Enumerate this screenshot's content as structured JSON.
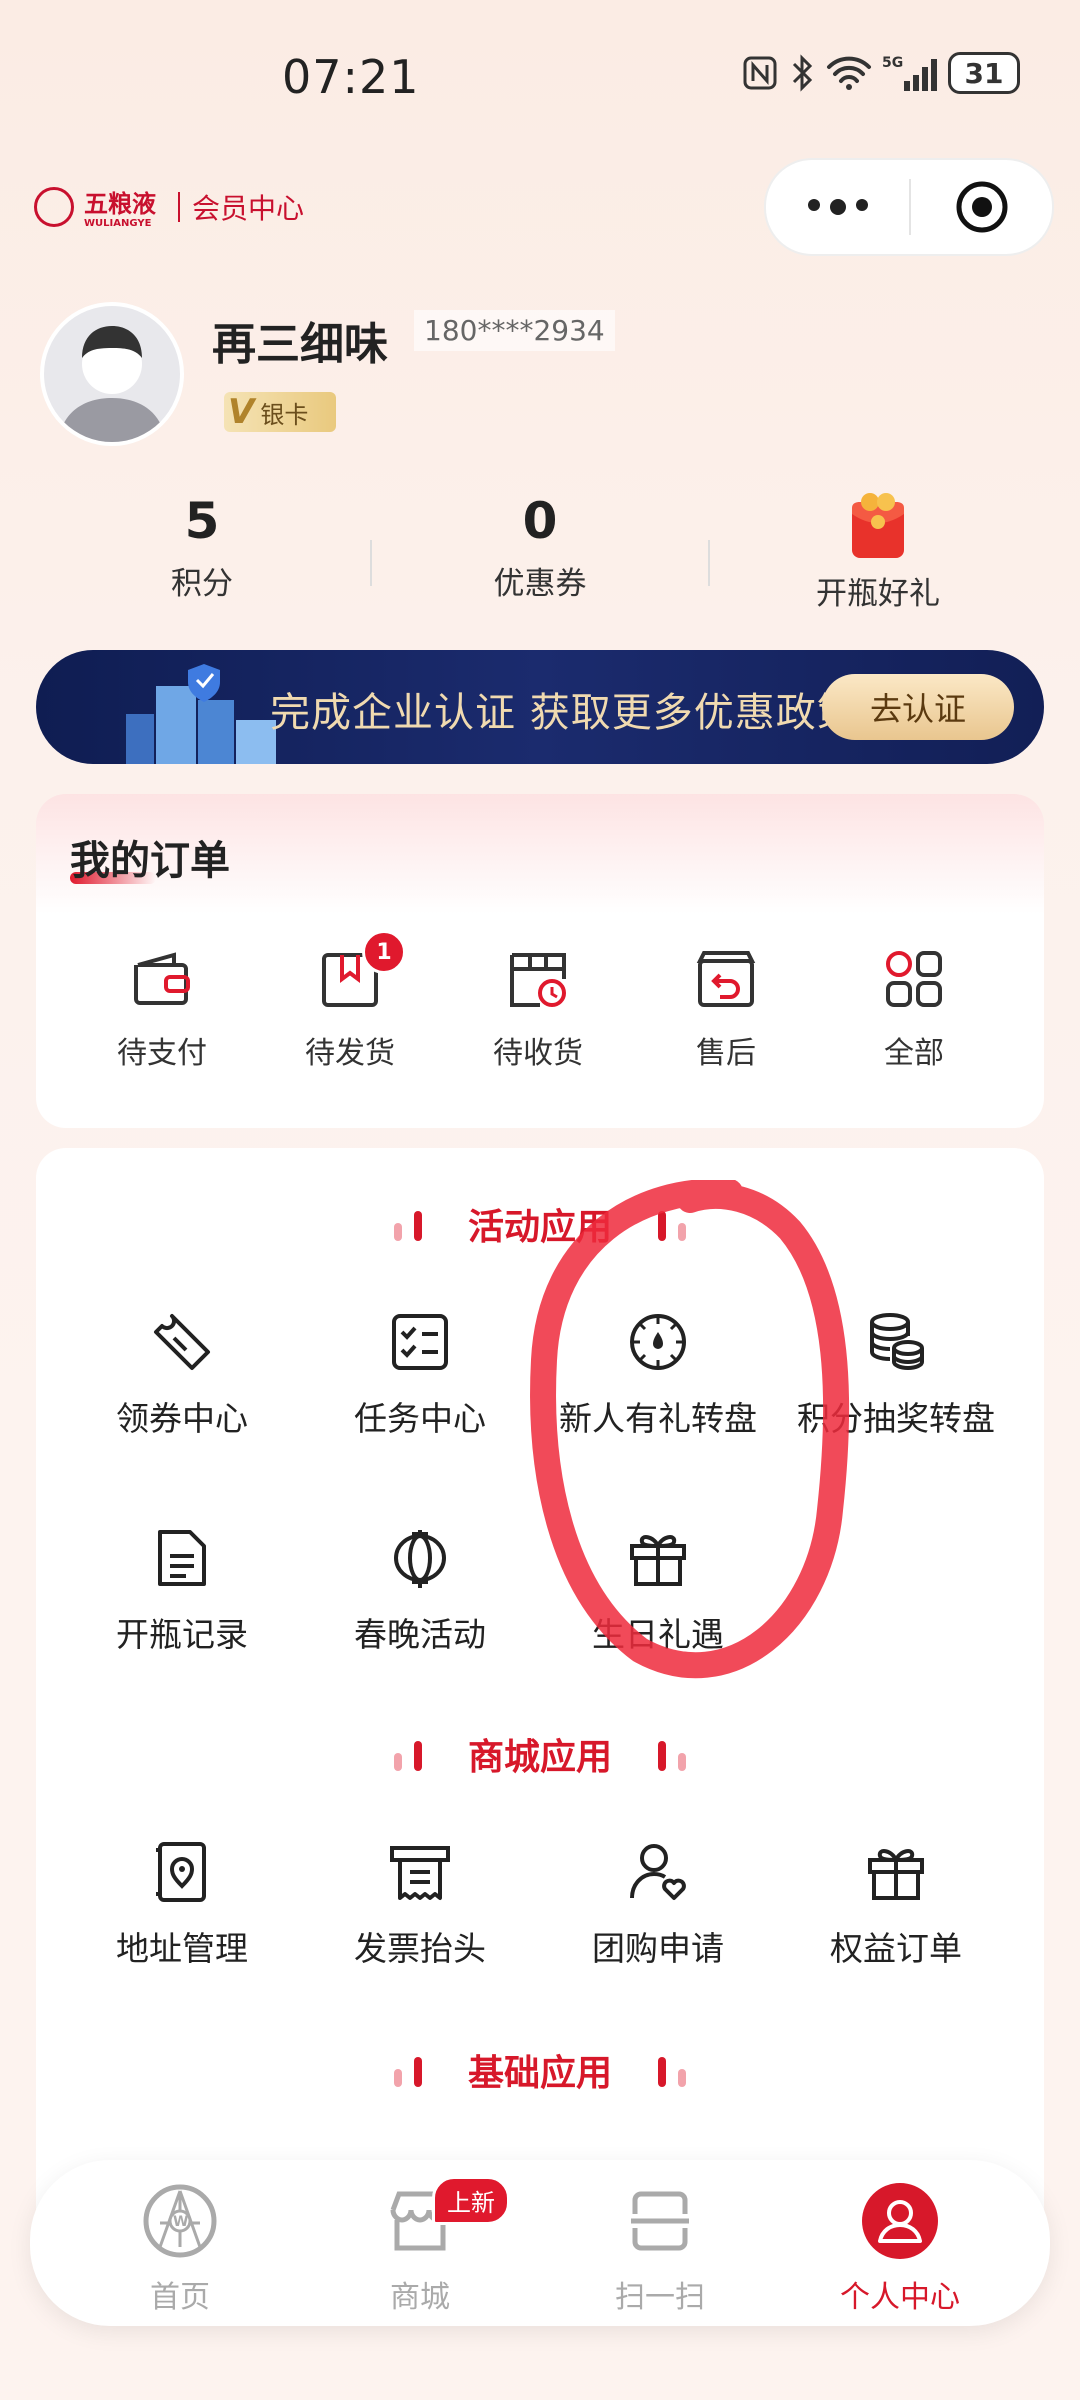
{
  "status_bar": {
    "time": "07:21",
    "battery": "31"
  },
  "header": {
    "brand_name": "五粮液",
    "brand_sub": "WULIANGYE",
    "brand_section": "会员中心"
  },
  "profile": {
    "nickname": "再三细味",
    "phone": "180****2934",
    "tier": "银卡"
  },
  "stats": [
    {
      "value": "5",
      "label": "积分"
    },
    {
      "value": "0",
      "label": "优惠券"
    },
    {
      "label": "开瓶好礼"
    }
  ],
  "banner": {
    "text": "完成企业认证 获取更多优惠政策",
    "button": "去认证"
  },
  "orders": {
    "title": "我的订单",
    "items": [
      {
        "label": "待支付",
        "icon": "wallet-icon"
      },
      {
        "label": "待发货",
        "icon": "package-icon",
        "badge": "1"
      },
      {
        "label": "待收货",
        "icon": "box-clock-icon"
      },
      {
        "label": "售后",
        "icon": "return-box-icon"
      },
      {
        "label": "全部",
        "icon": "grid-icon"
      }
    ]
  },
  "activity": {
    "title": "活动应用",
    "items": [
      {
        "label": "领券中心",
        "icon": "coupon-icon"
      },
      {
        "label": "任务中心",
        "icon": "checklist-icon"
      },
      {
        "label": "新人有礼转盘",
        "icon": "dial-icon"
      },
      {
        "label": "积分抽奖转盘",
        "icon": "coins-icon"
      },
      {
        "label": "开瓶记录",
        "icon": "document-icon"
      },
      {
        "label": "春晚活动",
        "icon": "lantern-icon"
      },
      {
        "label": "生日礼遇",
        "icon": "gift-icon"
      }
    ]
  },
  "mall": {
    "title": "商城应用",
    "items": [
      {
        "label": "地址管理",
        "icon": "location-book-icon"
      },
      {
        "label": "发票抬头",
        "icon": "invoice-icon"
      },
      {
        "label": "团购申请",
        "icon": "user-heart-icon"
      },
      {
        "label": "权益订单",
        "icon": "gift-icon"
      }
    ]
  },
  "basic": {
    "title": "基础应用"
  },
  "tabbar": {
    "items": [
      {
        "label": "首页",
        "icon": "home-logo-icon"
      },
      {
        "label": "商城",
        "icon": "store-icon",
        "badge": "上新"
      },
      {
        "label": "扫一扫",
        "icon": "scan-icon"
      },
      {
        "label": "个人中心",
        "icon": "user-icon",
        "active": true
      }
    ]
  },
  "colors": {
    "accent": "#d7182a",
    "banner_bg": "#12205a",
    "gold": "#e9c68f"
  }
}
